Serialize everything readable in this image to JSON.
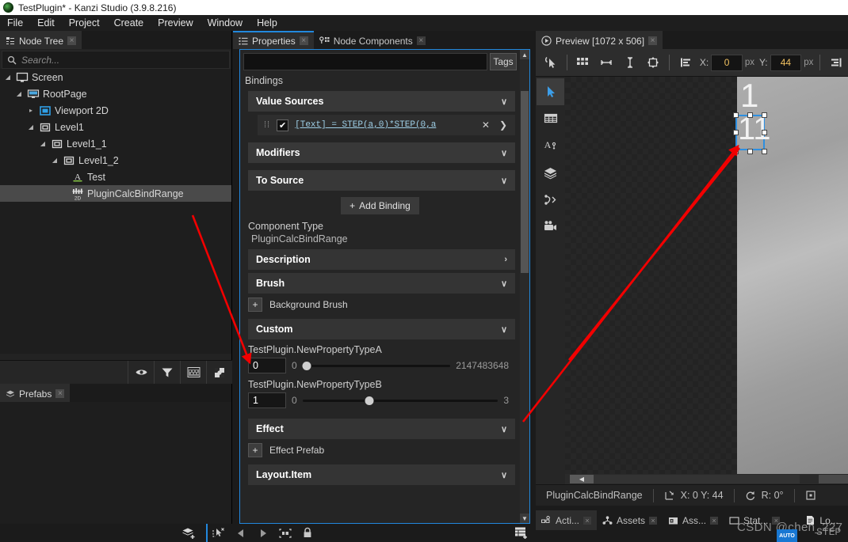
{
  "window": {
    "title": "TestPlugin* - Kanzi Studio (3.9.8.216)",
    "logo_icon": "kanzi-logo-icon"
  },
  "menubar": {
    "items": [
      "File",
      "Edit",
      "Project",
      "Create",
      "Preview",
      "Window",
      "Help"
    ]
  },
  "node_tree": {
    "tab": {
      "label": "Node Tree",
      "close": "×"
    },
    "search": {
      "placeholder": "Search...",
      "value": "",
      "icon": "search-icon"
    },
    "items": [
      {
        "label": "Screen",
        "depth": 0,
        "icon": "screen-icon",
        "twisty": "◢",
        "selected": false
      },
      {
        "label": "RootPage",
        "depth": 1,
        "icon": "page-icon",
        "twisty": "◢",
        "selected": false
      },
      {
        "label": "Viewport 2D",
        "depth": 2,
        "icon": "viewport-icon",
        "twisty": "▸",
        "selected": false
      },
      {
        "label": "Level1",
        "depth": 2,
        "icon": "node2d-icon",
        "twisty": "◢",
        "selected": false
      },
      {
        "label": "Level1_1",
        "depth": 3,
        "icon": "node2d-icon",
        "twisty": "◢",
        "selected": false
      },
      {
        "label": "Level1_2",
        "depth": 4,
        "icon": "node2d-icon",
        "twisty": "◢",
        "selected": false
      },
      {
        "label": "Test",
        "depth": 5,
        "icon": "text-node-icon",
        "twisty": "",
        "selected": false
      },
      {
        "label": "PluginCalcBindRange",
        "depth": 5,
        "icon": "plugin2d-icon",
        "twisty": "",
        "selected": true
      }
    ],
    "toolbar": [
      {
        "name": "visibility-eye-icon"
      },
      {
        "name": "filter-icon"
      },
      {
        "name": "grid-icon"
      },
      {
        "name": "checker-icon"
      }
    ]
  },
  "prefabs": {
    "tab": {
      "label": "Prefabs",
      "close": "×",
      "icon": "prefabs-icon"
    }
  },
  "properties": {
    "tabs": [
      {
        "label": "Properties",
        "icon": "properties-icon",
        "active": true,
        "close": "×"
      },
      {
        "label": "Node Components",
        "icon": "node-components-icon",
        "active": false,
        "close": "×"
      }
    ],
    "tag_filter": {
      "value": "",
      "button_label": "Tags"
    },
    "bindings_label": "Bindings",
    "sections": {
      "value_sources": {
        "label": "Value Sources",
        "chevron": "∨"
      },
      "modifiers": {
        "label": "Modifiers",
        "chevron": "∨"
      },
      "to_source": {
        "label": "To Source",
        "chevron": "∨"
      },
      "description": {
        "label": "Description",
        "chevron": "›"
      },
      "brush": {
        "label": "Brush",
        "chevron": "∨"
      },
      "custom": {
        "label": "Custom",
        "chevron": "∨"
      },
      "effect": {
        "label": "Effect",
        "chevron": "∨"
      },
      "layout_item": {
        "label": "Layout.Item",
        "chevron": "∨"
      }
    },
    "binding": {
      "grip_icon": "drag-grip-icon",
      "enabled": true,
      "check_glyph": "✔",
      "expression": "[Text] = STEP(a,0)*STEP(0,a",
      "remove_glyph": "✕",
      "expand_glyph": "❯"
    },
    "add_binding": {
      "label": "Add Binding",
      "plus": "+"
    },
    "component_type": {
      "label": "Component Type",
      "value": "PluginCalcBindRange"
    },
    "background_brush": {
      "label": "Background Brush",
      "plus": "+"
    },
    "effect_prefab": {
      "label": "Effect Prefab",
      "plus": "+"
    },
    "custom_properties": [
      {
        "name": "TestPlugin.NewPropertyTypeA",
        "value": "0",
        "min": "0",
        "max": "2147483648",
        "knob_pct": 1
      },
      {
        "name": "TestPlugin.NewPropertyTypeB",
        "value": "1",
        "min": "0",
        "max": "3",
        "knob_pct": 33
      }
    ]
  },
  "preview": {
    "tab": {
      "label": "Preview [1072 x 506]",
      "icon": "play-icon",
      "close": "×"
    },
    "toolbar": {
      "tools": [
        {
          "name": "pick-cursor-icon"
        },
        {
          "name": "grid-layout-icon"
        },
        {
          "name": "distribute-horizontal-icon"
        },
        {
          "name": "distribute-vertical-icon"
        },
        {
          "name": "fit-content-icon"
        },
        {
          "name": "align-left-icon"
        }
      ],
      "x_label": "X:",
      "x_value": "0",
      "x_unit": "px",
      "y_label": "Y:",
      "y_value": "44",
      "y_unit": "px",
      "right_tool": {
        "name": "align-right-icon"
      }
    },
    "side_tools": [
      {
        "name": "select-arrow-icon",
        "active": true
      },
      {
        "name": "table-icon",
        "active": false
      },
      {
        "name": "text-tool-icon",
        "active": false
      },
      {
        "name": "layers-icon",
        "active": false
      },
      {
        "name": "node-graph-icon",
        "active": false
      },
      {
        "name": "camera-icon",
        "active": false
      }
    ],
    "canvas": {
      "label_top": "1",
      "selected_text": "11"
    },
    "status": {
      "node_name": "PluginCalcBindRange",
      "transform_icon": "transform-icon",
      "position": "X: 0  Y: 44",
      "rotate_icon": "rotate-icon",
      "rotation": "R: 0°",
      "scale_icon": "scale-icon"
    }
  },
  "bottom_tabs": [
    {
      "label": "Acti...",
      "icon": "animation-icon",
      "close": "×",
      "selected": true
    },
    {
      "label": "Assets",
      "icon": "assets-icon",
      "close": "×",
      "selected": false
    },
    {
      "label": "Ass...",
      "icon": "asset-pkg-icon",
      "close": "×",
      "selected": false
    },
    {
      "label": "Stat...",
      "icon": "states-icon",
      "close": "×",
      "selected": false
    },
    {
      "label": "Lo...",
      "icon": "log-icon",
      "close": "",
      "selected": false
    }
  ],
  "status_strip": {
    "left_icon": "add-layer-icon",
    "icons": [
      {
        "name": "select-node-icon"
      },
      {
        "name": "step-back-icon"
      },
      {
        "name": "step-forward-icon"
      },
      {
        "name": "bounding-box-icon"
      },
      {
        "name": "lock-icon"
      }
    ],
    "right_icon": "add-table-icon"
  },
  "watermark": {
    "text": "CSDN @chen_227",
    "badge": "AUTO",
    "ghost": "STEP"
  },
  "colors": {
    "accent_blue": "#2288dd",
    "selection_blue": "#2e8fe0",
    "panel_bg": "#252525",
    "arrow_red": "#f20000"
  }
}
